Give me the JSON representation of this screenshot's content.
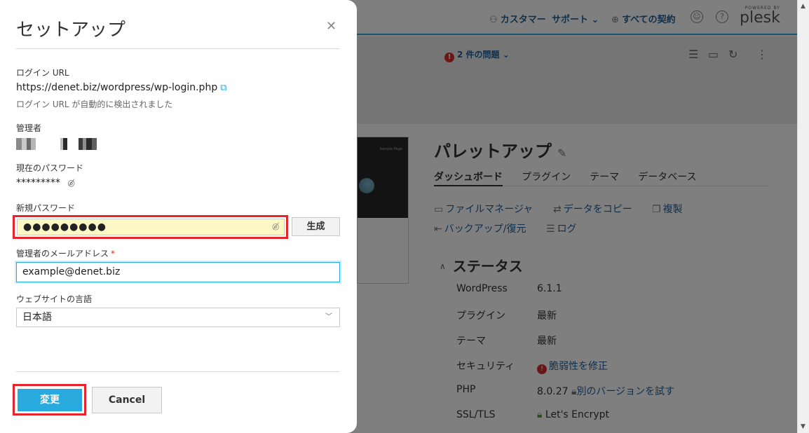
{
  "topbar": {
    "customer_menu": "カスタマー",
    "support_menu": "サポート ⌄",
    "subscriptions": "すべての契約",
    "logo_powered": "POWERED BY",
    "logo_word": "plesk"
  },
  "toolbar": {
    "issues_count": "!",
    "issues_label": "2 件の問題 ⌄"
  },
  "site": {
    "thumb_caption": "Sample Page",
    "title": "パレットアップ",
    "tabs": [
      "ダッシュボード",
      "プラグイン",
      "テーマ",
      "データベース"
    ],
    "actions": {
      "file_manager": "ファイルマネージャ",
      "copy_data": "データをコピー",
      "clone": "複製",
      "backup": "バックアップ/復元",
      "log": "ログ"
    },
    "status_heading": "ステータス",
    "status": {
      "wordpress_label": "WordPress",
      "wordpress_value": "6.1.1",
      "plugins_label": "プラグイン",
      "plugins_value": "最新",
      "theme_label": "テーマ",
      "theme_value": "最新",
      "security_label": "セキュリティ",
      "security_value": "脆弱性を修正",
      "php_label": "PHP",
      "php_value": "8.0.27",
      "php_link": "別のバージョンを試す",
      "ssl_label": "SSL/TLS",
      "ssl_value": "Let's Encrypt"
    }
  },
  "modal": {
    "title": "セットアップ",
    "login_url_label": "ログイン URL",
    "login_url": "https://denet.biz/wordpress/wp-login.php",
    "login_url_hint": "ログイン URL が自動的に検出されました",
    "admin_label": "管理者",
    "current_password_label": "現在のパスワード",
    "current_password_value": "*********",
    "new_password_label": "新規パスワード",
    "new_password_value": "●●●●●●●●●",
    "generate_button": "生成",
    "email_label": "管理者のメールアドレス",
    "required_mark": "*",
    "email_value": "example@denet.biz",
    "language_label": "ウェブサイトの言語",
    "language_value": "日本語",
    "ok_button": "変更",
    "cancel_button": "Cancel"
  },
  "colors": {
    "accent": "#28aade",
    "highlight_frame": "#e5242b",
    "password_bg": "#fdf7c3",
    "link": "#1f5f9a"
  }
}
